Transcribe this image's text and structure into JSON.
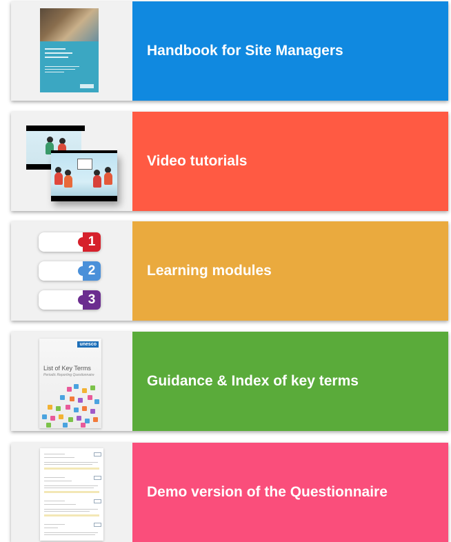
{
  "cards": [
    {
      "label": "Handbook for Site Managers",
      "color": "#1089e0"
    },
    {
      "label": "Video tutorials",
      "color": "#ff5a43"
    },
    {
      "label": "Learning modules",
      "color": "#eaaa3e"
    },
    {
      "label": "Guidance & Index of key terms",
      "color": "#5aab3a"
    },
    {
      "label": "Demo version of the Questionnaire",
      "color": "#fa4e7b"
    }
  ],
  "modules": {
    "numbers": [
      "1",
      "2",
      "3"
    ],
    "colors": [
      "#d6202b",
      "#4a90d9",
      "#6b2d8f"
    ]
  },
  "key_terms_doc": {
    "badge": "unesco",
    "title": "List of Key Terms",
    "subtitle": "Periodic Reporting Questionnaire"
  },
  "icons": [
    "handbook-cover-icon",
    "video-frames-icon",
    "numbered-tabs-icon",
    "key-terms-document-icon",
    "questionnaire-document-icon"
  ]
}
